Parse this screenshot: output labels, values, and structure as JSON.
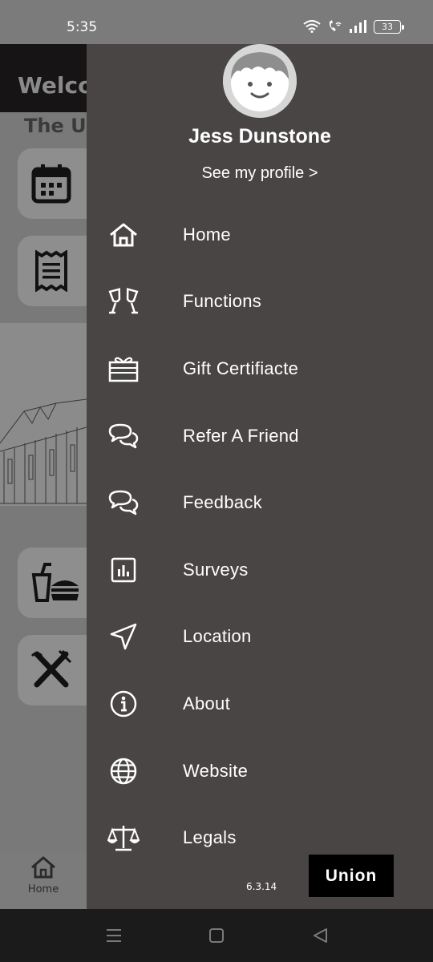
{
  "status_bar": {
    "time": "5:35",
    "battery": "33"
  },
  "background_app": {
    "welcome": "Welco",
    "venue": "The U",
    "nav_home_label": "Home"
  },
  "drawer": {
    "user_name": "Jess Dunstone",
    "profile_link": "See my profile >",
    "menu": [
      {
        "label": "Home",
        "icon": "home-icon"
      },
      {
        "label": "Functions",
        "icon": "cheers-glasses-icon"
      },
      {
        "label": "Gift Certifiacte",
        "icon": "gift-icon"
      },
      {
        "label": "Refer A Friend",
        "icon": "chat-bubbles-icon"
      },
      {
        "label": "Feedback",
        "icon": "chat-bubbles-icon"
      },
      {
        "label": "Surveys",
        "icon": "bar-chart-icon"
      },
      {
        "label": "Location",
        "icon": "navigation-arrow-icon"
      },
      {
        "label": "About",
        "icon": "info-icon"
      },
      {
        "label": "Website",
        "icon": "globe-icon"
      },
      {
        "label": "Legals",
        "icon": "scales-icon"
      }
    ],
    "version": "6.3.14",
    "brand": "Union"
  },
  "colors": {
    "drawer_bg": "#4a4545",
    "overlay": "#797979",
    "nav_bg": "#1b1b1b"
  }
}
